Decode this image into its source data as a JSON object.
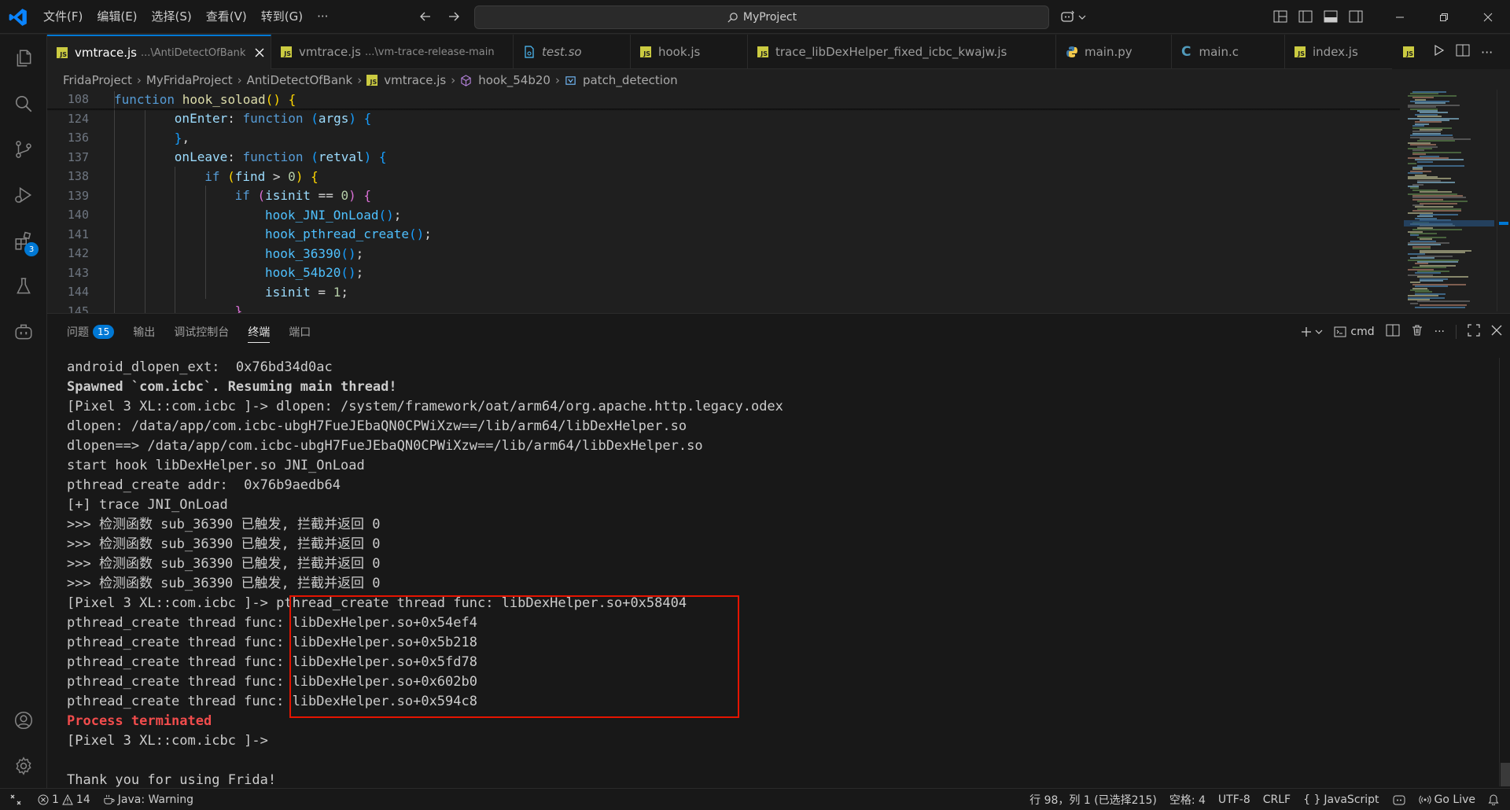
{
  "titlebar": {
    "menus": [
      "文件(F)",
      "编辑(E)",
      "选择(S)",
      "查看(V)",
      "转到(G)",
      "···"
    ],
    "search_label": "MyProject"
  },
  "tabs": [
    {
      "name": "vmtrace.js",
      "desc": "...\\AntiDetectOfBank",
      "type": "js",
      "active": true
    },
    {
      "name": "vmtrace.js",
      "desc": "...\\vm-trace-release-main",
      "type": "js"
    },
    {
      "name": "test.so",
      "desc": "",
      "type": "so"
    },
    {
      "name": "hook.js",
      "desc": "",
      "type": "js"
    },
    {
      "name": "trace_libDexHelper_fixed_icbc_kwajw.js",
      "desc": "",
      "type": "js"
    },
    {
      "name": "main.py",
      "desc": "",
      "type": "py"
    },
    {
      "name": "main.c",
      "desc": "",
      "type": "c"
    },
    {
      "name": "index.js",
      "desc": "",
      "type": "js"
    }
  ],
  "breadcrumb": {
    "p0": "FridaProject",
    "p1": "MyFridaProject",
    "p2": "AntiDetectOfBank",
    "p3": "vmtrace.js",
    "p4": "hook_54b20",
    "p5": "patch_detection"
  },
  "editor": {
    "lines": [
      {
        "n": "108",
        "indent": 0,
        "tokens": [
          [
            "k",
            "function "
          ],
          [
            "f",
            "hook_soload"
          ],
          [
            "b1",
            "("
          ],
          [
            "b1",
            ")"
          ],
          [
            "o",
            " "
          ],
          [
            "b1",
            "{"
          ]
        ]
      },
      {
        "n": "124",
        "indent": 2,
        "tokens": [
          [
            "p",
            "onEnter"
          ],
          [
            "o",
            ": "
          ],
          [
            "k",
            "function "
          ],
          [
            "b3",
            "("
          ],
          [
            "p",
            "args"
          ],
          [
            "b3",
            ")"
          ],
          [
            "o",
            " "
          ],
          [
            "b3",
            "{"
          ]
        ]
      },
      {
        "n": "136",
        "indent": 2,
        "tokens": [
          [
            "b3",
            "}"
          ],
          [
            "o",
            ","
          ]
        ]
      },
      {
        "n": "137",
        "indent": 2,
        "tokens": [
          [
            "p",
            "onLeave"
          ],
          [
            "o",
            ": "
          ],
          [
            "k",
            "function "
          ],
          [
            "b3",
            "("
          ],
          [
            "p",
            "retval"
          ],
          [
            "b3",
            ")"
          ],
          [
            "o",
            " "
          ],
          [
            "b3",
            "{"
          ]
        ]
      },
      {
        "n": "138",
        "indent": 3,
        "tokens": [
          [
            "k",
            "if "
          ],
          [
            "b1",
            "("
          ],
          [
            "p",
            "find"
          ],
          [
            "o",
            " > "
          ],
          [
            "n",
            "0"
          ],
          [
            "b1",
            ")"
          ],
          [
            "o",
            " "
          ],
          [
            "b1",
            "{"
          ]
        ]
      },
      {
        "n": "139",
        "indent": 4,
        "tokens": [
          [
            "k",
            "if "
          ],
          [
            "b2",
            "("
          ],
          [
            "p",
            "isinit"
          ],
          [
            "o",
            " == "
          ],
          [
            "n",
            "0"
          ],
          [
            "b2",
            ")"
          ],
          [
            "o",
            " "
          ],
          [
            "b2",
            "{"
          ]
        ]
      },
      {
        "n": "140",
        "indent": 5,
        "tokens": [
          [
            "fb",
            "hook_JNI_OnLoad"
          ],
          [
            "b3",
            "()"
          ],
          [
            "o",
            ";"
          ]
        ]
      },
      {
        "n": "141",
        "indent": 5,
        "tokens": [
          [
            "fb",
            "hook_pthread_create"
          ],
          [
            "b3",
            "()"
          ],
          [
            "o",
            ";"
          ]
        ]
      },
      {
        "n": "142",
        "indent": 5,
        "tokens": [
          [
            "fb",
            "hook_36390"
          ],
          [
            "b3",
            "()"
          ],
          [
            "o",
            ";"
          ]
        ]
      },
      {
        "n": "143",
        "indent": 5,
        "tokens": [
          [
            "fb",
            "hook_54b20"
          ],
          [
            "b3",
            "()"
          ],
          [
            "o",
            ";"
          ]
        ]
      },
      {
        "n": "144",
        "indent": 5,
        "tokens": [
          [
            "p",
            "isinit"
          ],
          [
            "o",
            " = "
          ],
          [
            "n",
            "1"
          ],
          [
            "o",
            ";"
          ]
        ]
      },
      {
        "n": "145",
        "indent": 4,
        "tokens": [
          [
            "b2",
            "}"
          ]
        ]
      }
    ]
  },
  "panel": {
    "tabs": [
      "问题",
      "输出",
      "调试控制台",
      "终端",
      "端口"
    ],
    "problems_count": "15",
    "active_tab": "终端",
    "shell_name": "cmd"
  },
  "terminal": {
    "lines": [
      {
        "text": "android_dlopen_ext:  0x76bd34d0ac",
        "style": ""
      },
      {
        "text": "Spawned `com.icbc`. Resuming main thread!",
        "style": "bold"
      },
      {
        "text": "[Pixel 3 XL::com.icbc ]-> dlopen: /system/framework/oat/arm64/org.apache.http.legacy.odex",
        "style": ""
      },
      {
        "text": "dlopen: /data/app/com.icbc-ubgH7FueJEbaQN0CPWiXzw==/lib/arm64/libDexHelper.so",
        "style": ""
      },
      {
        "text": "dlopen==> /data/app/com.icbc-ubgH7FueJEbaQN0CPWiXzw==/lib/arm64/libDexHelper.so",
        "style": ""
      },
      {
        "text": "start hook libDexHelper.so JNI_OnLoad",
        "style": ""
      },
      {
        "text": "pthread_create addr:  0x76b9aedb64",
        "style": ""
      },
      {
        "text": "[+] trace JNI_OnLoad",
        "style": ""
      },
      {
        "text": ">>> 检测函数 sub_36390 已触发, 拦截并返回 0",
        "style": ""
      },
      {
        "text": ">>> 检测函数 sub_36390 已触发, 拦截并返回 0",
        "style": ""
      },
      {
        "text": ">>> 检测函数 sub_36390 已触发, 拦截并返回 0",
        "style": ""
      },
      {
        "text": ">>> 检测函数 sub_36390 已触发, 拦截并返回 0",
        "style": ""
      },
      {
        "text": "[Pixel 3 XL::com.icbc ]-> pthread_create thread func: libDexHelper.so+0x58404",
        "style": ""
      },
      {
        "text": "pthread_create thread func: libDexHelper.so+0x54ef4",
        "style": ""
      },
      {
        "text": "pthread_create thread func: libDexHelper.so+0x5b218",
        "style": ""
      },
      {
        "text": "pthread_create thread func: libDexHelper.so+0x5fd78",
        "style": ""
      },
      {
        "text": "pthread_create thread func: libDexHelper.so+0x602b0",
        "style": ""
      },
      {
        "text": "pthread_create thread func: libDexHelper.so+0x594c8",
        "style": ""
      },
      {
        "text": "Process terminated",
        "style": "red"
      },
      {
        "text": "[Pixel 3 XL::com.icbc ]->",
        "style": ""
      },
      {
        "text": "",
        "style": ""
      },
      {
        "text": "Thank you for using Frida!",
        "style": ""
      }
    ]
  },
  "statusbar": {
    "errors": "1",
    "warnings": "14",
    "java": "Java: Warning",
    "position": "行 98，列 1 (已选择215)",
    "spaces": "空格: 4",
    "encoding": "UTF-8",
    "eol": "CRLF",
    "language": "JavaScript",
    "golive": "Go Live"
  },
  "colors": {
    "accent": "#0078d4",
    "error_red": "#f14c4c",
    "highlight_box": "#e51400",
    "js_icon": "#cbcb41"
  }
}
